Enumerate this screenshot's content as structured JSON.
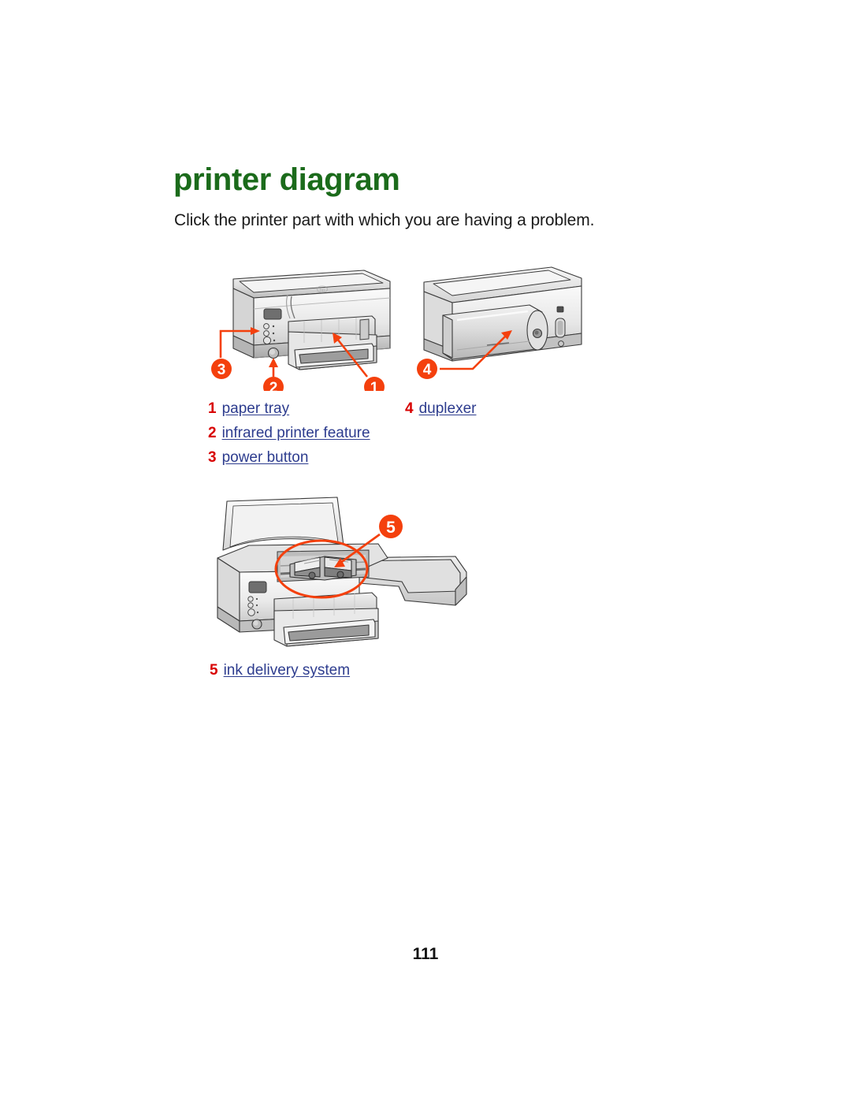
{
  "document": {
    "title": "printer diagram",
    "subtitle": "Click the printer part with which you are having a problem.",
    "page_number": "111"
  },
  "colors": {
    "heading_green": "#1b6b1b",
    "callout_orange": "#f4400d",
    "legend_number_red": "#d80000",
    "legend_link_blue": "#2d3c8e",
    "body_text": "#1a1a1a"
  },
  "legend": {
    "left_column": [
      {
        "number": "1",
        "label": "paper tray"
      },
      {
        "number": "2",
        "label": "infrared printer feature"
      },
      {
        "number": "3",
        "label": "power button"
      }
    ],
    "right_column": [
      {
        "number": "4",
        "label": "duplexer"
      }
    ],
    "ink_column": [
      {
        "number": "5",
        "label": "ink delivery system"
      }
    ]
  },
  "figures": {
    "front_view": {
      "name": "printer-front-view",
      "callouts": [
        {
          "number": "1",
          "target": "paper tray"
        },
        {
          "number": "2",
          "target": "infrared printer feature"
        },
        {
          "number": "3",
          "target": "power button"
        }
      ]
    },
    "rear_view": {
      "name": "printer-rear-view",
      "callouts": [
        {
          "number": "4",
          "target": "duplexer"
        }
      ]
    },
    "open_view": {
      "name": "printer-open-cover-view",
      "callouts": [
        {
          "number": "5",
          "target": "ink delivery system"
        }
      ]
    }
  }
}
